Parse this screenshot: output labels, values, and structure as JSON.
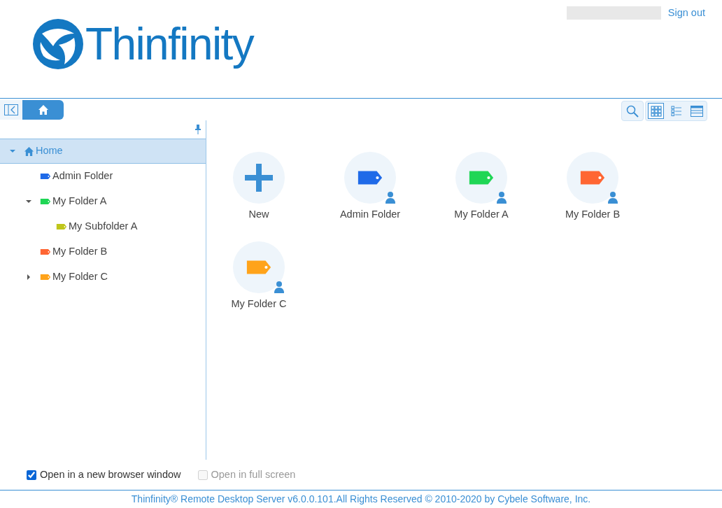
{
  "header": {
    "logo_text": "Thinfinity",
    "sign_out": "Sign out"
  },
  "toolbar": {
    "views": [
      {
        "kind": "grid",
        "selected": true
      },
      {
        "kind": "list",
        "selected": false
      },
      {
        "kind": "details",
        "selected": false
      }
    ]
  },
  "tree": [
    {
      "label": "Home",
      "kind": "home",
      "selected": true,
      "expanded": true,
      "children": [
        {
          "label": "Admin Folder",
          "kind": "folder",
          "color": "#1f6ae8",
          "selected": false
        },
        {
          "label": "My Folder A",
          "kind": "folder",
          "color": "#1fd655",
          "selected": false,
          "expanded": true,
          "children": [
            {
              "label": "My Subfolder A",
              "kind": "folder",
              "color": "#bfc61a",
              "selected": false
            }
          ]
        },
        {
          "label": "My Folder B",
          "kind": "folder",
          "color": "#ff6633",
          "selected": false
        },
        {
          "label": "My Folder C",
          "kind": "folder",
          "color": "#ffa31a",
          "selected": false,
          "expandable": true,
          "expanded": false
        }
      ]
    }
  ],
  "items": [
    {
      "kind": "new",
      "label": "New"
    },
    {
      "kind": "folder",
      "label": "Admin Folder",
      "color": "#1f6ae8",
      "shared": true
    },
    {
      "kind": "folder",
      "label": "My Folder A",
      "color": "#1fd655",
      "shared": true
    },
    {
      "kind": "folder",
      "label": "My Folder B",
      "color": "#ff6633",
      "shared": true
    },
    {
      "kind": "folder",
      "label": "My Folder C",
      "color": "#ffa31a",
      "shared": true
    }
  ],
  "options": [
    {
      "label": "Open in a new browser window",
      "checked": true,
      "disabled": false
    },
    {
      "label": "Open in full screen",
      "checked": false,
      "disabled": true
    }
  ],
  "footer": "Thinfinity® Remote Desktop Server v6.0.0.101.All Rights Reserved © 2010-2020 by Cybele Software, Inc."
}
